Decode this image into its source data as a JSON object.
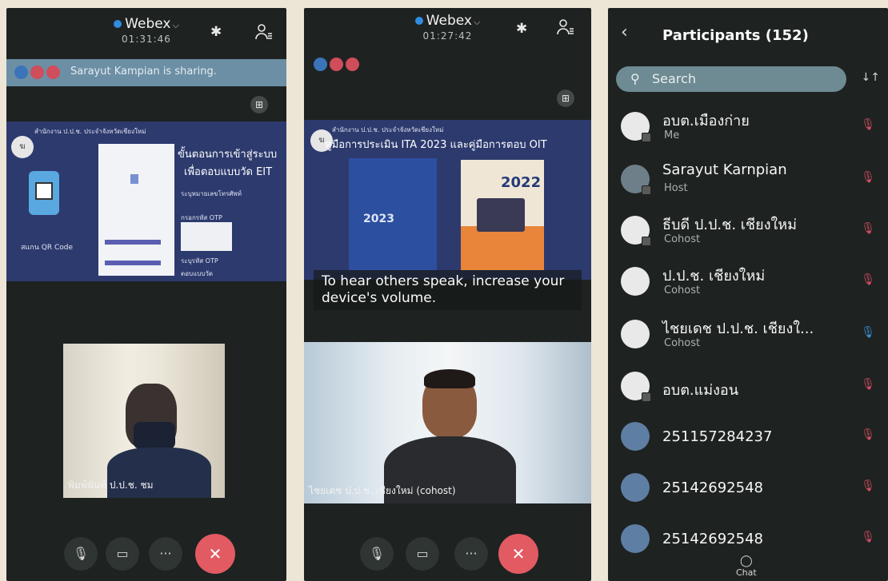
{
  "panel1": {
    "app_title": "Webex",
    "timer": "01:31:46",
    "share_text": "Sarayut Kampian is sharing.",
    "slide_header": "สำนักงาน ป.ป.ช. ประจำจังหวัดเชียงใหม่",
    "slide_title_1": "ขั้นตอนการเข้าสู่ระบบ",
    "slide_title_2": "เพื่อตอบแบบวัด EIT",
    "slide_label_qr": "สแกน QR Code",
    "slide_item_1": "ระบุหมายเลขโทรศัพท์",
    "slide_item_2": "กรอกรหัส OTP",
    "slide_item_3": "ระบุรหัส OTP",
    "slide_item_4": "ตอบแบบวัด",
    "video_label": "พิมพ์นันท์ ป.ป.ช. ชม"
  },
  "panel2": {
    "app_title": "Webex",
    "timer": "01:27:42",
    "slide_header": "สำนักงาน ป.ป.ช. ประจำจังหวัดเชียงใหม่",
    "slide_title": "คู่มือการประเมิน ITA 2023 และคู่มือการตอบ OIT",
    "book_year_left": "2023",
    "book_year_right": "2022",
    "toast": "To hear others speak, increase your device's volume.",
    "video_label": "ไชยเดช ป.ป.ช. เชียงใหม่ (cohost)"
  },
  "controls": {
    "more": "···",
    "end": "✕"
  },
  "panel3": {
    "title": "Participants (152)",
    "search_placeholder": "Search",
    "participants": [
      {
        "name": "อบต.เมืองก่าย",
        "role": "Me"
      },
      {
        "name": "Sarayut Karnpian",
        "role": "Host"
      },
      {
        "name": "ธีบดี ป.ป.ช. เชียงใหม่",
        "role": "Cohost"
      },
      {
        "name": "ป.ป.ช. เชียงใหม่",
        "role": "Cohost"
      },
      {
        "name": "ไชยเดช ป.ป.ช. เชียงใ...",
        "role": "Cohost"
      },
      {
        "name": "อบต.แม่งอน",
        "role": ""
      },
      {
        "name": "251157284237",
        "role": ""
      },
      {
        "name": "25142692548",
        "role": ""
      },
      {
        "name": "25142692548",
        "role": ""
      }
    ],
    "chat_label": "Chat"
  },
  "colors": {
    "panel_bg": "#1e2221",
    "share_bar": "#6c8fa5",
    "end_call": "#e25a62",
    "mic_muted": "#d44e62",
    "webex_blue": "#2f8de0"
  }
}
